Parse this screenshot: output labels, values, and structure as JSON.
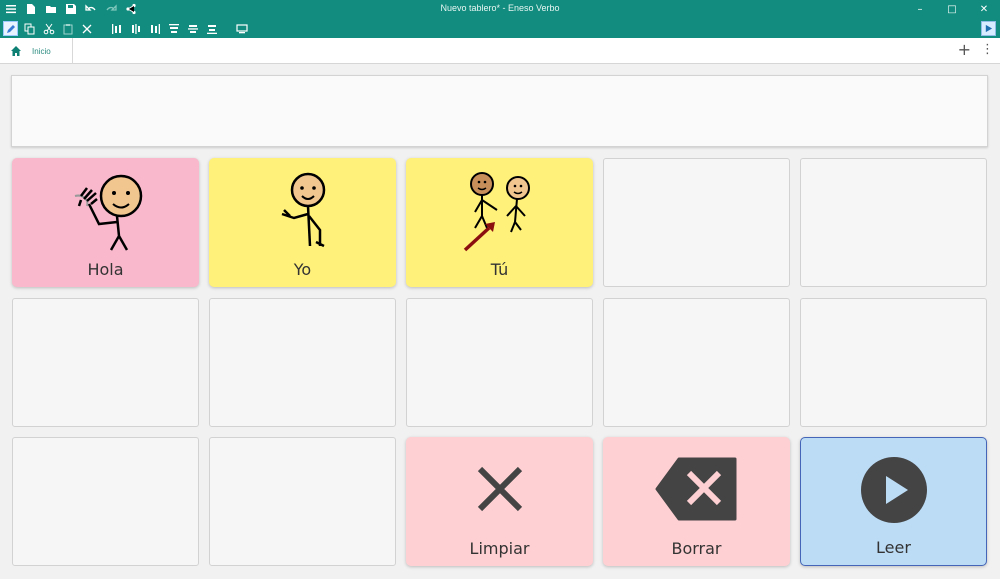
{
  "window": {
    "title": "Nuevo tablero* - Eneso Verbo",
    "minimize": "–",
    "maximize": "□",
    "close": "✕"
  },
  "tabs": [
    {
      "label": "Inicio",
      "icon": "home-icon"
    }
  ],
  "tabbar_actions": {
    "add": "+",
    "more": "⋮"
  },
  "colors": {
    "brand": "#128c7e",
    "pink": "#f9b8cc",
    "yellow": "#fff17a",
    "light_pink": "#ffd0d3",
    "light_blue": "#bcdcf6",
    "empty": "#f6f6f6"
  },
  "grid": {
    "rows": [
      [
        {
          "label": "Hola",
          "color": "pink",
          "picto": "waving-person"
        },
        {
          "label": "Yo",
          "color": "yellow",
          "picto": "person-pointing-self"
        },
        {
          "label": "Tú",
          "color": "yellow",
          "picto": "person-pointing-other"
        },
        {
          "label": "",
          "color": "empty"
        },
        {
          "label": "",
          "color": "empty"
        }
      ],
      [
        {
          "label": "",
          "color": "empty"
        },
        {
          "label": "",
          "color": "empty"
        },
        {
          "label": "",
          "color": "empty"
        },
        {
          "label": "",
          "color": "empty"
        },
        {
          "label": "",
          "color": "empty"
        }
      ],
      [
        {
          "label": "",
          "color": "empty"
        },
        {
          "label": "",
          "color": "empty"
        },
        {
          "label": "Limpiar",
          "color": "light_pink",
          "picto": "clear-x-icon"
        },
        {
          "label": "Borrar",
          "color": "light_pink",
          "picto": "backspace-icon"
        },
        {
          "label": "Leer",
          "color": "light_blue",
          "picto": "play-icon"
        }
      ]
    ]
  }
}
